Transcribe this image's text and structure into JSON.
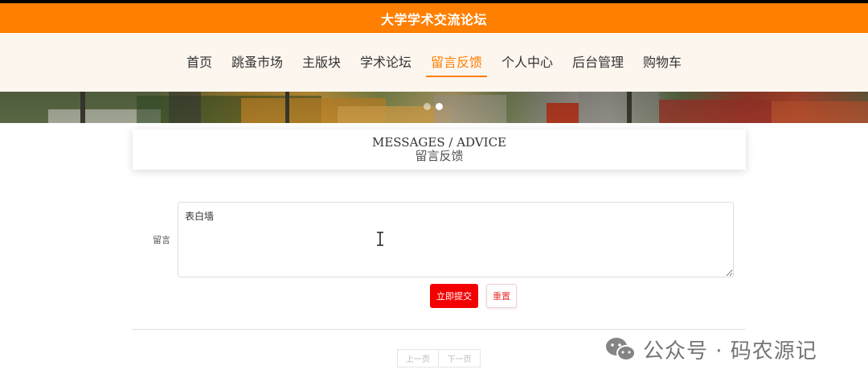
{
  "header": {
    "site_title": "大学学术交流论坛"
  },
  "nav": {
    "items": [
      {
        "label": "首页",
        "active": false
      },
      {
        "label": "跳蚤市场",
        "active": false
      },
      {
        "label": "主版块",
        "active": false
      },
      {
        "label": "学术论坛",
        "active": false
      },
      {
        "label": "留言反馈",
        "active": true
      },
      {
        "label": "个人中心",
        "active": false
      },
      {
        "label": "后台管理",
        "active": false
      },
      {
        "label": "购物车",
        "active": false
      }
    ],
    "accent_color": "#ff7f00"
  },
  "banner": {
    "slide_count": 2,
    "active_slide": 2
  },
  "page_title": {
    "en": "MESSAGES / ADVICE",
    "zh": "留言反馈"
  },
  "form": {
    "message_label": "留言",
    "message_value": "表白墙",
    "submit_label": "立即提交",
    "reset_label": "重置",
    "submit_color": "#f40000"
  },
  "pager": {
    "prev_label": "上一页",
    "next_label": "下一页"
  },
  "watermark": {
    "text": "公众号 · 码农源记",
    "icon": "wechat-icon"
  }
}
